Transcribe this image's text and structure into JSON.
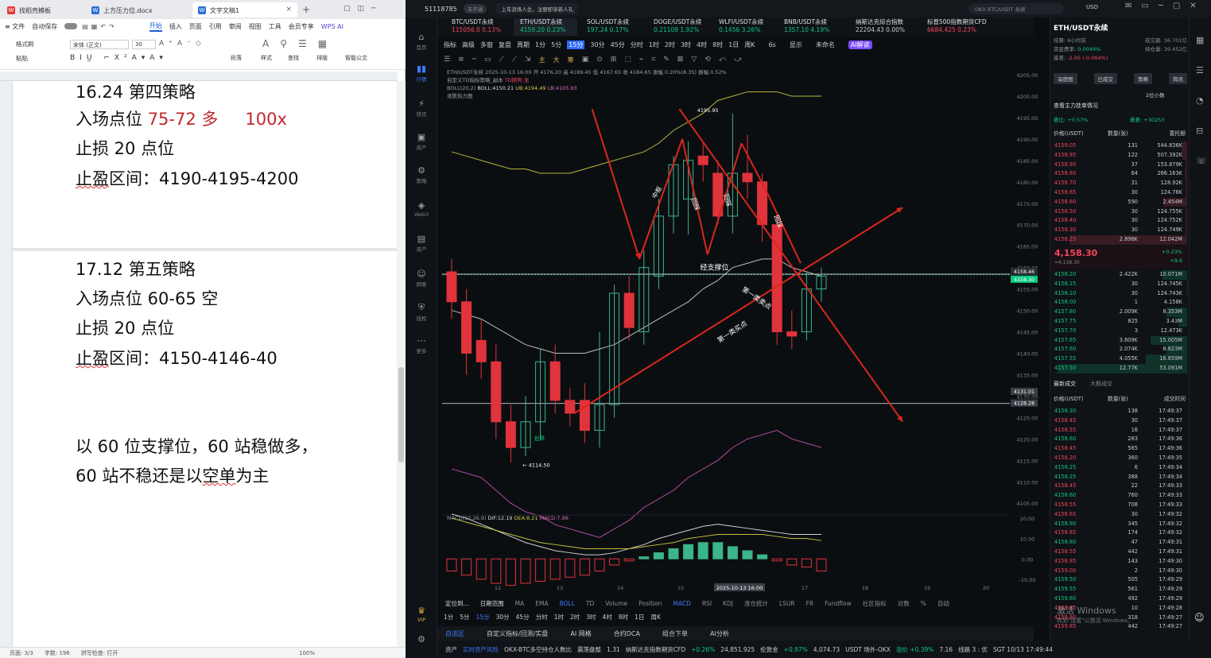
{
  "wps": {
    "tabs": [
      {
        "label": "找稻壳模板"
      },
      {
        "label": "上方压力位.docx"
      },
      {
        "label": "文字文稿1"
      }
    ],
    "menu": [
      "≡ 文件",
      "自动保存",
      "开始",
      "插入",
      "页面",
      "引用",
      "审阅",
      "视图",
      "工具",
      "会员专享",
      "WPS AI"
    ],
    "ribbon": {
      "font": "宋体 (正文)",
      "size": "30",
      "format_brush": "格式刷",
      "paste": "粘贴",
      "styles": "样式",
      "find": "查找",
      "layout": "排版",
      "smart": "智能公文",
      "paragraph": "段落"
    },
    "doc": {
      "l1": "16.24  第四策略",
      "l2a": "入场点位 ",
      "l2b": "75-72  多",
      "l2c": "100x",
      "l3": "止损 20 点位",
      "l4a": "止盈",
      "l4b": "区间：4190-4195-4200",
      "l5": "17.12  第五策略",
      "l6": "入场点位  60-65  空",
      "l7": "止损 20 点位",
      "l8a": "止盈",
      "l8b": "区间：4150-4146-40",
      "l9": "以 60 位支撑位，60 站稳做多，",
      "l10a": "60 站不稳还是以",
      "l10b": "空单",
      "l10c": "为主"
    },
    "status": {
      "page": "页面: 3/3",
      "words": "字数: 196",
      "spell": "拼写检查: 打开",
      "zoom": "100%"
    }
  },
  "tv": {
    "uid": "51118785",
    "badge": "未开通",
    "notice": "上车浪场人生，注册即享新人礼",
    "search": "OKX BTC/USDT 永续",
    "currency": "USD",
    "symbols": [
      {
        "name": "BTC/USDT永续",
        "price": "115056.0",
        "chg": "0.13%",
        "up": false
      },
      {
        "name": "ETH/USDT永续",
        "price": "4159.20",
        "chg": "0.23%",
        "up": true
      },
      {
        "name": "SOL/USDT永续",
        "price": "197.24",
        "chg": "0.17%",
        "up": true
      },
      {
        "name": "DOGE/USDT永续",
        "price": "0.21109",
        "chg": "1.92%",
        "up": true
      },
      {
        "name": "WLFI/USDT永续",
        "price": "0.1456",
        "chg": "3.26%",
        "up": true
      },
      {
        "name": "BNB/USDT永续",
        "price": "1357.10",
        "chg": "4.19%",
        "up": true
      },
      {
        "name": "纳斯达克综合指数",
        "price": "22204.43",
        "chg": "0.00%",
        "up": null
      },
      {
        "name": "标普500指数期货CFD",
        "price": "6684.425",
        "chg": "0.23%",
        "up": false
      }
    ],
    "sidebar": [
      "首页",
      "行情",
      "快讯",
      "资产",
      "策略",
      "Web3",
      "资产",
      "群聊",
      "授权",
      "更多",
      "VIP"
    ],
    "toolbar1": [
      "指标",
      "高级",
      "多窗",
      "复盘",
      "周期",
      "1分",
      "5分",
      "15分",
      "30分",
      "45分",
      "分时",
      "1时",
      "2时",
      "3时",
      "4时",
      "8时",
      "1日",
      "周K"
    ],
    "toolbar1_right": {
      "t": "6s",
      "show": "显示",
      "unnamed": "未命名",
      "ai": "AI解读"
    },
    "chart_info": {
      "line1": "ETH/USDT永续  2025-10-13 16:00  开 4176.20  高 4189.45  低 4167.65  收 4184.65  涨幅 0.20%(8.35)  振幅 0.52%",
      "line2": "自定义TD指标策略_副本",
      "line2b": "TD研判 无",
      "boll": "BOLL(20,2)",
      "boll_mid": "BOLL:4150.21",
      "boll_ub": "UB:4194.49",
      "boll_lb": "LB:4105.93",
      "hot": "涨跌热力图",
      "macd": "MACD(12,26,9)",
      "dif": "DIF:12.19",
      "dea": "DEA:8.21",
      "macdv": "MACD:7.96"
    },
    "annotations": {
      "high": "4195.95",
      "low": "4114.50",
      "support": "经支撑位",
      "first_sell": "第一类卖点",
      "first_buy": "第一类买点",
      "a1": "中枢",
      "a2": "回踩",
      "a3": "回踩",
      "a4": "回踩",
      "start": "起跌"
    },
    "price_axis": [
      "4205.00",
      "4200.00",
      "4195.00",
      "4190.00",
      "4185.00",
      "4180.00",
      "4175.00",
      "4170.00",
      "4165.00",
      "4160.00",
      "4155.00",
      "4150.00",
      "4145.00",
      "4140.00",
      "4135.00",
      "4130.00",
      "4125.00",
      "4120.00",
      "4115.00",
      "4110.00",
      "4105.00"
    ],
    "price_tags": [
      "4158.46",
      "4158.30",
      "4131.01",
      "4128.28"
    ],
    "macd_axis": [
      "20.00",
      "10.00",
      "0.00",
      "-10.00"
    ],
    "date_axis": [
      "12",
      "13",
      "14",
      "15",
      "2025-10-13 16:00",
      "17",
      "18",
      "19",
      "20"
    ],
    "chart_data": {
      "type": "candlestick",
      "candles": [
        {
          "o": 4159,
          "c": 4152,
          "h": 4162,
          "l": 4148
        },
        {
          "o": 4152,
          "c": 4140,
          "h": 4155,
          "l": 4135
        },
        {
          "o": 4143,
          "c": 4138,
          "h": 4148,
          "l": 4134
        },
        {
          "o": 4138,
          "c": 4124,
          "h": 4142,
          "l": 4120
        },
        {
          "o": 4124,
          "c": 4118,
          "h": 4128,
          "l": 4114.5
        },
        {
          "o": 4118,
          "c": 4124,
          "h": 4130,
          "l": 4116
        },
        {
          "o": 4124,
          "c": 4138,
          "h": 4141,
          "l": 4120
        },
        {
          "o": 4138,
          "c": 4129,
          "h": 4142,
          "l": 4126
        },
        {
          "o": 4129,
          "c": 4126,
          "h": 4132,
          "l": 4123
        },
        {
          "o": 4129,
          "c": 4122,
          "h": 4133,
          "l": 4119
        },
        {
          "o": 4122,
          "c": 4128,
          "h": 4145,
          "l": 4118
        },
        {
          "o": 4128,
          "c": 4154,
          "h": 4156,
          "l": 4125
        },
        {
          "o": 4154,
          "c": 4146,
          "h": 4158,
          "l": 4143
        },
        {
          "o": 4145,
          "c": 4160,
          "h": 4164,
          "l": 4142
        },
        {
          "o": 4158,
          "c": 4172,
          "h": 4176,
          "l": 4155
        },
        {
          "o": 4172,
          "c": 4184,
          "h": 4186,
          "l": 4168
        },
        {
          "o": 4176,
          "c": 4185,
          "h": 4189.5,
          "l": 4167.7
        },
        {
          "o": 4186,
          "c": 4184,
          "h": 4189,
          "l": 4180
        },
        {
          "o": 4182,
          "c": 4172,
          "h": 4185,
          "l": 4170
        },
        {
          "o": 4172,
          "c": 4182,
          "h": 4195.95,
          "l": 4168
        },
        {
          "o": 4182,
          "c": 4180,
          "h": 4191,
          "l": 4176
        },
        {
          "o": 4180,
          "c": 4170,
          "h": 4182,
          "l": 4166
        },
        {
          "o": 4170,
          "c": 4145,
          "h": 4172,
          "l": 4142
        },
        {
          "o": 4145,
          "c": 4144,
          "h": 4150,
          "l": 4141
        },
        {
          "o": 4145,
          "c": 4155,
          "h": 4159,
          "l": 4143
        },
        {
          "o": 4155,
          "c": 4158,
          "h": 4160,
          "l": 4152
        }
      ],
      "boll_ub": [
        4187,
        4186,
        4185,
        4184,
        4183,
        4183,
        4182,
        4182,
        4182,
        4183,
        4184,
        4185,
        4186,
        4187,
        4189,
        4192,
        4194,
        4196,
        4199,
        4200,
        4201,
        4201,
        4201,
        4200,
        4200,
        4200
      ],
      "boll_mid": [
        4150,
        4149,
        4148,
        4146,
        4144,
        4142,
        4141,
        4140,
        4140,
        4140,
        4141,
        4142,
        4144,
        4146,
        4148,
        4150,
        4152,
        4155,
        4157,
        4160,
        4161,
        4162,
        4162,
        4160,
        4159,
        4158
      ],
      "boll_lb": [
        4113,
        4112,
        4111,
        4108,
        4105,
        4103,
        4102,
        4100,
        4099,
        4098,
        4097,
        4099,
        4101,
        4104,
        4106,
        4108,
        4111,
        4113,
        4115,
        4118,
        4120,
        4121,
        4122,
        4120,
        4119,
        4118
      ],
      "macd_hist": [
        -6,
        -8,
        -10,
        -12,
        -13,
        -12,
        -11,
        -10,
        -9,
        -8,
        -6,
        -3,
        -1,
        1,
        3,
        5,
        7,
        8,
        8,
        6,
        4,
        2,
        -1,
        -3,
        -4,
        -6
      ],
      "dif": [
        22,
        20,
        17,
        14,
        11,
        8,
        6,
        4,
        3,
        2,
        2,
        3,
        5,
        7,
        10,
        12,
        14,
        16,
        17,
        16,
        15,
        14,
        13,
        12,
        12,
        12
      ],
      "dea": [
        20,
        18,
        16,
        14,
        12,
        10,
        8,
        7,
        6,
        5,
        5,
        5,
        5,
        6,
        7,
        8,
        10,
        11,
        12,
        12,
        12,
        12,
        11,
        10,
        10,
        9
      ]
    },
    "btm_tabs": [
      "定位到...",
      "日期范围",
      "MA",
      "EMA",
      "BOLL",
      "TD",
      "Volume",
      "Position",
      "MACD",
      "RSI",
      "KDJ",
      "涨仓统计",
      "LSUR",
      "FR",
      "Fundflow",
      "社区指标",
      "对数",
      "%",
      "自动"
    ],
    "btm_periods": [
      "1分",
      "5分",
      "15分",
      "30分",
      "45分",
      "分时",
      "1时",
      "2时",
      "3时",
      "4时",
      "8时",
      "1日",
      "周K"
    ],
    "btm3": [
      "自选区",
      "自定义指标/回测/实盘",
      "AI 网格",
      "合约DCA",
      "组合下单",
      "AI分析"
    ],
    "btm4": [
      {
        "t": "资产"
      },
      {
        "t": "实时资产风险"
      },
      {
        "t": "OKX-BTC多空持仓人数比"
      },
      {
        "t": "震荡盘整"
      },
      {
        "t": "1.31"
      },
      {
        "t": "纳斯达克指数期货CFD"
      },
      {
        "t": "+0.26%"
      },
      {
        "t": "24,851.925"
      },
      {
        "t": "伦敦金"
      },
      {
        "t": "+0.97%"
      },
      {
        "t": "4,074.73"
      },
      {
        "t": "USDT 场外-OKX"
      },
      {
        "t": "溢价 +0.39%"
      },
      {
        "t": "7.16"
      },
      {
        "t": "线路 3 : 优"
      },
      {
        "t": "SGT 10/13 17:49:44"
      }
    ],
    "right": {
      "title": "ETH/USDT永续",
      "fund_rate_lbl": "结算:",
      "fund_rate": "6小时前",
      "vol_lbl": "成交额:",
      "vol": "36.701亿",
      "rate_lbl": "资金费率:",
      "rate": "0.0049%",
      "oi_lbl": "持仓量:",
      "oi": "39.452亿",
      "basis_lbl": "基差:",
      "basis": "-2.65 (-0.064%)",
      "tabs": [
        "深度图",
        "已成交",
        "策略",
        "简讯"
      ],
      "depth": "2位小数",
      "main_force": "查看主力挂单情况",
      "weibi": "委比: +0.57%",
      "weicha": "委差: +30253",
      "hdr": [
        "价格(USDT)",
        "数量(张)",
        "委托额"
      ],
      "asks": [
        [
          "4159.05",
          "131",
          "544.836K"
        ],
        [
          "4158.95",
          "122",
          "507.392K"
        ],
        [
          "4158.90",
          "37",
          "153.879K"
        ],
        [
          "4158.80",
          "64",
          "266.163K"
        ],
        [
          "4158.70",
          "31",
          "128.92K"
        ],
        [
          "4158.65",
          "30",
          "124.76K"
        ],
        [
          "4158.60",
          "590",
          "2.454M"
        ],
        [
          "4158.50",
          "30",
          "124.755K"
        ],
        [
          "4158.40",
          "30",
          "124.752K"
        ],
        [
          "4158.30",
          "30",
          "124.749K"
        ],
        [
          "4158.25",
          "2.896K",
          "12.042M"
        ]
      ],
      "last": "4,158.30",
      "last_usd": "≈4,158.30",
      "last_chg": "+0.23%",
      "last_chg2": "+9.6",
      "bids": [
        [
          "4158.20",
          "2.422K",
          "10.071M"
        ],
        [
          "4158.15",
          "30",
          "124.745K"
        ],
        [
          "4158.10",
          "30",
          "124.743K"
        ],
        [
          "4158.00",
          "1",
          "4.158K"
        ],
        [
          "4157.80",
          "2.009K",
          "8.353M"
        ],
        [
          "4157.75",
          "825",
          "3.43M"
        ],
        [
          "4157.70",
          "3",
          "12.473K"
        ],
        [
          "4157.65",
          "3.609K",
          "15.005M"
        ],
        [
          "4157.60",
          "2.074K",
          "8.623M"
        ],
        [
          "4157.55",
          "4.055K",
          "16.859M"
        ],
        [
          "4157.50",
          "12.77K",
          "53.091M"
        ]
      ],
      "trades_title": "最新成交",
      "trades_tab2": "大额成交",
      "thdr": [
        "价格(USDT)",
        "数量(张)",
        "成交时间"
      ],
      "trades": [
        [
          "4158.30",
          "138",
          "17:49:37",
          1
        ],
        [
          "4158.45",
          "30",
          "17:49:37",
          0
        ],
        [
          "4158.55",
          "16",
          "17:49:37",
          0
        ],
        [
          "4158.60",
          "283",
          "17:49:36",
          1
        ],
        [
          "4158.45",
          "565",
          "17:49:36",
          0
        ],
        [
          "4158.20",
          "360",
          "17:49:35",
          0
        ],
        [
          "4158.25",
          "6",
          "17:49:34",
          1
        ],
        [
          "4158.25",
          "388",
          "17:49:34",
          1
        ],
        [
          "4158.45",
          "22",
          "17:49:33",
          0
        ],
        [
          "4158.60",
          "760",
          "17:49:33",
          1
        ],
        [
          "4158.55",
          "708",
          "17:49:33",
          0
        ],
        [
          "4158.65",
          "30",
          "17:49:32",
          0
        ],
        [
          "4158.90",
          "345",
          "17:49:32",
          1
        ],
        [
          "4158.85",
          "174",
          "17:49:32",
          0
        ],
        [
          "4158.80",
          "47",
          "17:49:31",
          1
        ],
        [
          "4158.55",
          "442",
          "17:49:31",
          0
        ],
        [
          "4158.85",
          "143",
          "17:49:30",
          0
        ],
        [
          "4159.00",
          "2",
          "17:49:30",
          0
        ],
        [
          "4159.50",
          "505",
          "17:49:29",
          1
        ],
        [
          "4159.55",
          "561",
          "17:49:29",
          1
        ],
        [
          "4159.60",
          "492",
          "17:49:29",
          1
        ],
        [
          "4159.85",
          "10",
          "17:49:28",
          0
        ],
        [
          "4159.80",
          "318",
          "17:49:27",
          0
        ],
        [
          "4159.85",
          "442",
          "17:49:27",
          0
        ]
      ],
      "watermark1": "激活 Windows",
      "watermark2": "转到\"设置\"以激活 Windows。"
    },
    "colors": {
      "up": "#0ecb81",
      "down": "#f6465d",
      "candle_down": "#e0333c",
      "candle_up": "#3bb58a",
      "anno": "#d9261c",
      "boll": "#c2c23a"
    }
  }
}
